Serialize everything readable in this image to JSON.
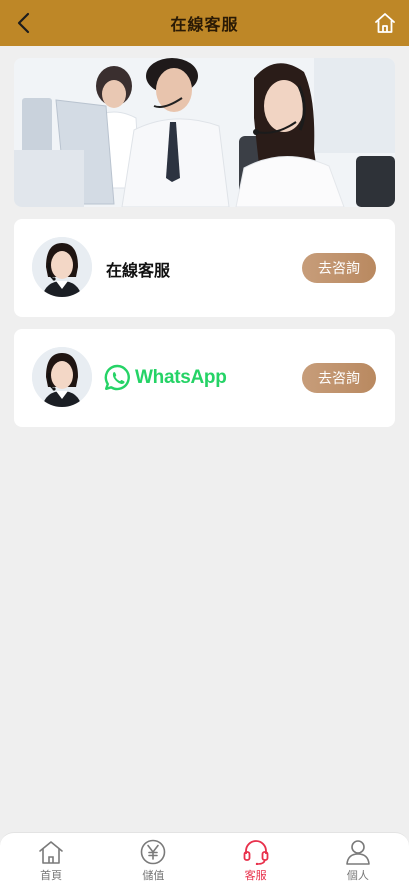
{
  "header": {
    "title": "在線客服",
    "back_icon": "back-arrow-icon",
    "home_icon": "home-icon"
  },
  "services": [
    {
      "name": "在線客服",
      "button": "去咨詢"
    },
    {
      "name": "WhatsApp",
      "button": "去咨詢"
    }
  ],
  "tabs": [
    {
      "label": "首頁",
      "icon": "home-icon",
      "active": false
    },
    {
      "label": "儲值",
      "icon": "yen-icon",
      "active": false
    },
    {
      "label": "客服",
      "icon": "headset-icon",
      "active": true
    },
    {
      "label": "個人",
      "icon": "user-icon",
      "active": false
    }
  ],
  "colors": {
    "header_bg": "#be8727",
    "button_bg": "#c29470",
    "whatsapp_green": "#25d366",
    "tab_active": "#e8304b"
  }
}
